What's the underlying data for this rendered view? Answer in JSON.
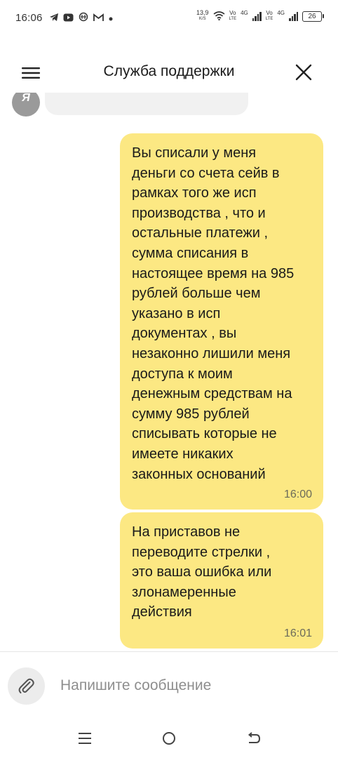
{
  "status_bar": {
    "time": "16:06",
    "net_speed_value": "13,9",
    "net_speed_unit": "K/S",
    "sim1_top": "Vo",
    "sim1_bottom": "LTE",
    "sim1_gen": "4G",
    "sim2_top": "Vo",
    "sim2_bottom": "LTE",
    "sim2_gen": "4G",
    "battery": "26",
    "icons": [
      "telegram-icon",
      "youtube-icon",
      "cryptocurrency-icon",
      "gmail-icon",
      "dot-icon",
      "wifi-icon",
      "signal-icon",
      "battery-icon"
    ]
  },
  "header": {
    "title": "Служба поддержки",
    "menu_icon": "hamburger-menu-icon",
    "close_icon": "close-icon"
  },
  "chat": {
    "partial_avatar_letter": "Я",
    "messages": [
      {
        "text": "Вы списали у меня\nденьги со счета сейв в\nрамках того же исп\nпроизводства , что и\nостальные платежи ,\nсумма списания в\nнастоящее время на 985\nрублей больше чем\nуказано в исп\nдокументах , вы\nнезаконно лишили меня\nдоступа к моим\nденежным средствам на\nсумму 985 рублей\nсписывать которые не\nимеете никаких\nзаконных оснований",
        "time": "16:00"
      },
      {
        "text": "На приставов не\nпереводите стрелки ,\nэто ваша ошибка или\nзлонамеренные\nдействия",
        "time": "16:01"
      }
    ],
    "bubble_color": "#fce883"
  },
  "composer": {
    "placeholder": "Напишите сообщение",
    "value": "",
    "attach_icon": "paperclip-icon"
  },
  "nav_bar": {
    "icons": [
      "recent-apps-icon",
      "home-icon",
      "back-icon"
    ]
  }
}
